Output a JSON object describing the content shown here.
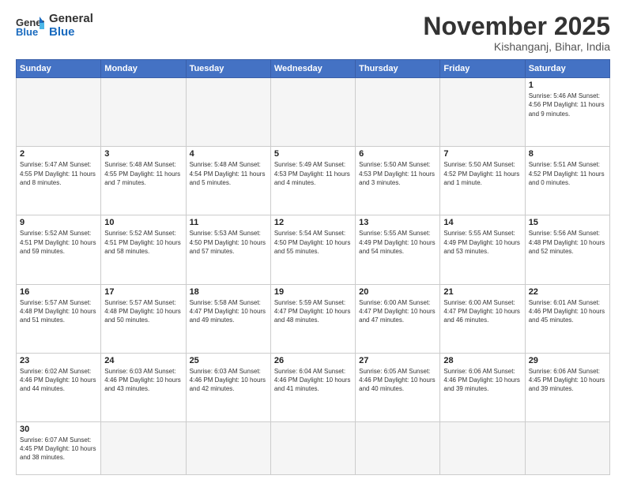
{
  "header": {
    "logo_general": "General",
    "logo_blue": "Blue",
    "month_title": "November 2025",
    "subtitle": "Kishanganj, Bihar, India"
  },
  "days_of_week": [
    "Sunday",
    "Monday",
    "Tuesday",
    "Wednesday",
    "Thursday",
    "Friday",
    "Saturday"
  ],
  "weeks": [
    [
      {
        "day": "",
        "info": ""
      },
      {
        "day": "",
        "info": ""
      },
      {
        "day": "",
        "info": ""
      },
      {
        "day": "",
        "info": ""
      },
      {
        "day": "",
        "info": ""
      },
      {
        "day": "",
        "info": ""
      },
      {
        "day": "1",
        "info": "Sunrise: 5:46 AM\nSunset: 4:56 PM\nDaylight: 11 hours\nand 9 minutes."
      }
    ],
    [
      {
        "day": "2",
        "info": "Sunrise: 5:47 AM\nSunset: 4:55 PM\nDaylight: 11 hours\nand 8 minutes."
      },
      {
        "day": "3",
        "info": "Sunrise: 5:48 AM\nSunset: 4:55 PM\nDaylight: 11 hours\nand 7 minutes."
      },
      {
        "day": "4",
        "info": "Sunrise: 5:48 AM\nSunset: 4:54 PM\nDaylight: 11 hours\nand 5 minutes."
      },
      {
        "day": "5",
        "info": "Sunrise: 5:49 AM\nSunset: 4:53 PM\nDaylight: 11 hours\nand 4 minutes."
      },
      {
        "day": "6",
        "info": "Sunrise: 5:50 AM\nSunset: 4:53 PM\nDaylight: 11 hours\nand 3 minutes."
      },
      {
        "day": "7",
        "info": "Sunrise: 5:50 AM\nSunset: 4:52 PM\nDaylight: 11 hours\nand 1 minute."
      },
      {
        "day": "8",
        "info": "Sunrise: 5:51 AM\nSunset: 4:52 PM\nDaylight: 11 hours\nand 0 minutes."
      }
    ],
    [
      {
        "day": "9",
        "info": "Sunrise: 5:52 AM\nSunset: 4:51 PM\nDaylight: 10 hours\nand 59 minutes."
      },
      {
        "day": "10",
        "info": "Sunrise: 5:52 AM\nSunset: 4:51 PM\nDaylight: 10 hours\nand 58 minutes."
      },
      {
        "day": "11",
        "info": "Sunrise: 5:53 AM\nSunset: 4:50 PM\nDaylight: 10 hours\nand 57 minutes."
      },
      {
        "day": "12",
        "info": "Sunrise: 5:54 AM\nSunset: 4:50 PM\nDaylight: 10 hours\nand 55 minutes."
      },
      {
        "day": "13",
        "info": "Sunrise: 5:55 AM\nSunset: 4:49 PM\nDaylight: 10 hours\nand 54 minutes."
      },
      {
        "day": "14",
        "info": "Sunrise: 5:55 AM\nSunset: 4:49 PM\nDaylight: 10 hours\nand 53 minutes."
      },
      {
        "day": "15",
        "info": "Sunrise: 5:56 AM\nSunset: 4:48 PM\nDaylight: 10 hours\nand 52 minutes."
      }
    ],
    [
      {
        "day": "16",
        "info": "Sunrise: 5:57 AM\nSunset: 4:48 PM\nDaylight: 10 hours\nand 51 minutes."
      },
      {
        "day": "17",
        "info": "Sunrise: 5:57 AM\nSunset: 4:48 PM\nDaylight: 10 hours\nand 50 minutes."
      },
      {
        "day": "18",
        "info": "Sunrise: 5:58 AM\nSunset: 4:47 PM\nDaylight: 10 hours\nand 49 minutes."
      },
      {
        "day": "19",
        "info": "Sunrise: 5:59 AM\nSunset: 4:47 PM\nDaylight: 10 hours\nand 48 minutes."
      },
      {
        "day": "20",
        "info": "Sunrise: 6:00 AM\nSunset: 4:47 PM\nDaylight: 10 hours\nand 47 minutes."
      },
      {
        "day": "21",
        "info": "Sunrise: 6:00 AM\nSunset: 4:47 PM\nDaylight: 10 hours\nand 46 minutes."
      },
      {
        "day": "22",
        "info": "Sunrise: 6:01 AM\nSunset: 4:46 PM\nDaylight: 10 hours\nand 45 minutes."
      }
    ],
    [
      {
        "day": "23",
        "info": "Sunrise: 6:02 AM\nSunset: 4:46 PM\nDaylight: 10 hours\nand 44 minutes."
      },
      {
        "day": "24",
        "info": "Sunrise: 6:03 AM\nSunset: 4:46 PM\nDaylight: 10 hours\nand 43 minutes."
      },
      {
        "day": "25",
        "info": "Sunrise: 6:03 AM\nSunset: 4:46 PM\nDaylight: 10 hours\nand 42 minutes."
      },
      {
        "day": "26",
        "info": "Sunrise: 6:04 AM\nSunset: 4:46 PM\nDaylight: 10 hours\nand 41 minutes."
      },
      {
        "day": "27",
        "info": "Sunrise: 6:05 AM\nSunset: 4:46 PM\nDaylight: 10 hours\nand 40 minutes."
      },
      {
        "day": "28",
        "info": "Sunrise: 6:06 AM\nSunset: 4:46 PM\nDaylight: 10 hours\nand 39 minutes."
      },
      {
        "day": "29",
        "info": "Sunrise: 6:06 AM\nSunset: 4:45 PM\nDaylight: 10 hours\nand 39 minutes."
      }
    ],
    [
      {
        "day": "30",
        "info": "Sunrise: 6:07 AM\nSunset: 4:45 PM\nDaylight: 10 hours\nand 38 minutes."
      },
      {
        "day": "",
        "info": ""
      },
      {
        "day": "",
        "info": ""
      },
      {
        "day": "",
        "info": ""
      },
      {
        "day": "",
        "info": ""
      },
      {
        "day": "",
        "info": ""
      },
      {
        "day": "",
        "info": ""
      }
    ]
  ]
}
